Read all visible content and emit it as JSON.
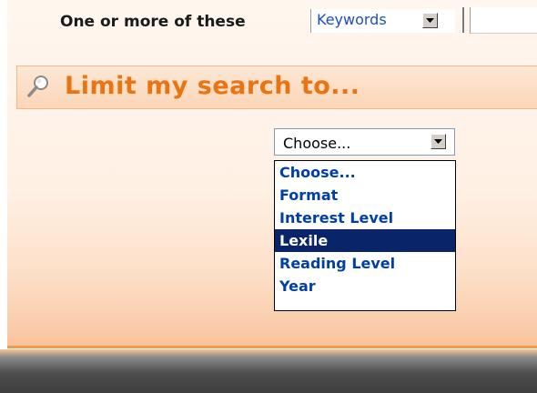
{
  "search_row": {
    "label": "One or more of these",
    "field_select": {
      "selected": "Keywords"
    },
    "text_value": ""
  },
  "limit_section": {
    "title": "Limit my search to...",
    "icon": "magnifier-icon",
    "title_color": "#ea7412"
  },
  "limit_select": {
    "selected": "Choose...",
    "highlighted": "Lexile",
    "options": [
      {
        "label": "Choose..."
      },
      {
        "label": "Format"
      },
      {
        "label": "Interest Level"
      },
      {
        "label": "Lexile"
      },
      {
        "label": "Reading Level"
      },
      {
        "label": "Year"
      }
    ]
  },
  "colors": {
    "highlight_bg": "#0a246a",
    "option_text": "#003fa8",
    "accent_orange": "#ea7412"
  }
}
